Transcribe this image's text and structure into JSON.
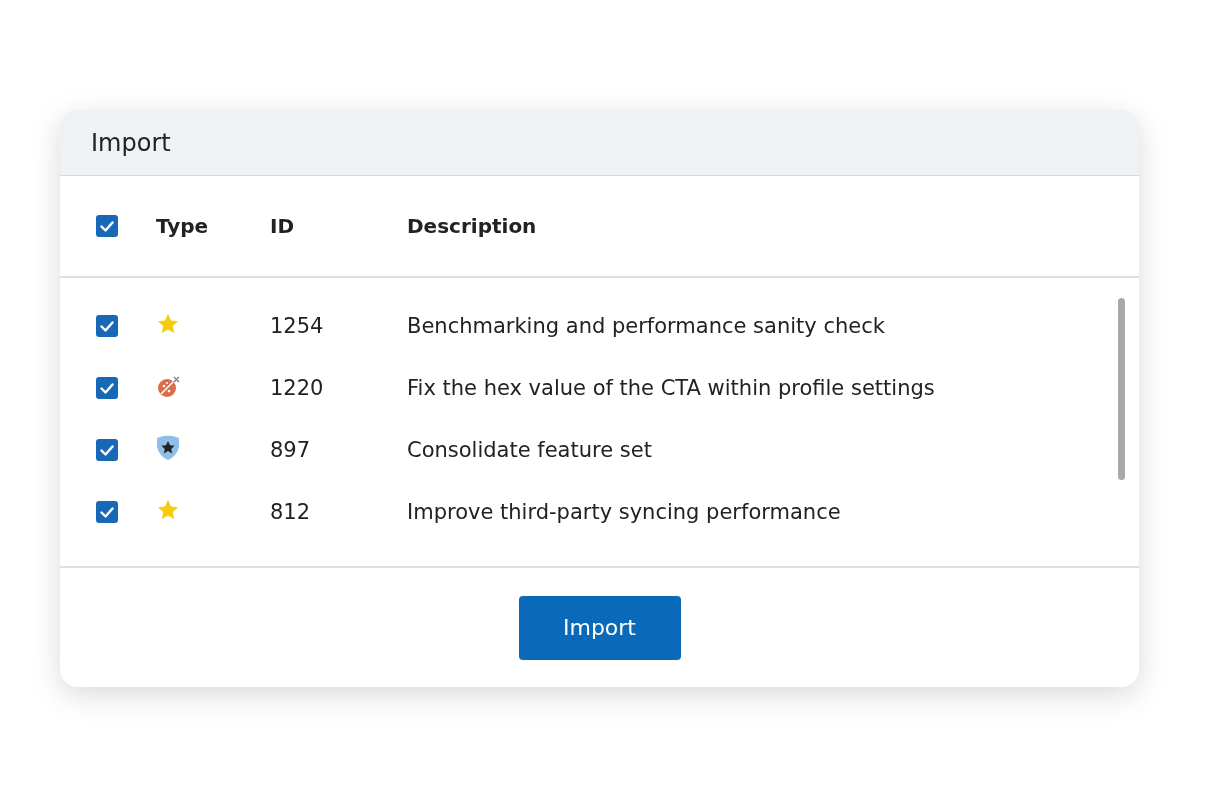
{
  "dialog": {
    "title": "Import"
  },
  "table": {
    "all_checked": true,
    "columns": [
      "Type",
      "ID",
      "Description"
    ],
    "rows": [
      {
        "checked": true,
        "kind": "story",
        "id": "1254",
        "description": "Benchmarking and performance sanity check"
      },
      {
        "checked": true,
        "kind": "bug",
        "id": "1220",
        "description": "Fix the hex value of the CTA within profile settings"
      },
      {
        "checked": true,
        "kind": "epic",
        "id": "897",
        "description": "Consolidate feature set"
      },
      {
        "checked": true,
        "kind": "story",
        "id": "812",
        "description": "Improve third-party syncing performance"
      }
    ]
  },
  "button": "Import"
}
